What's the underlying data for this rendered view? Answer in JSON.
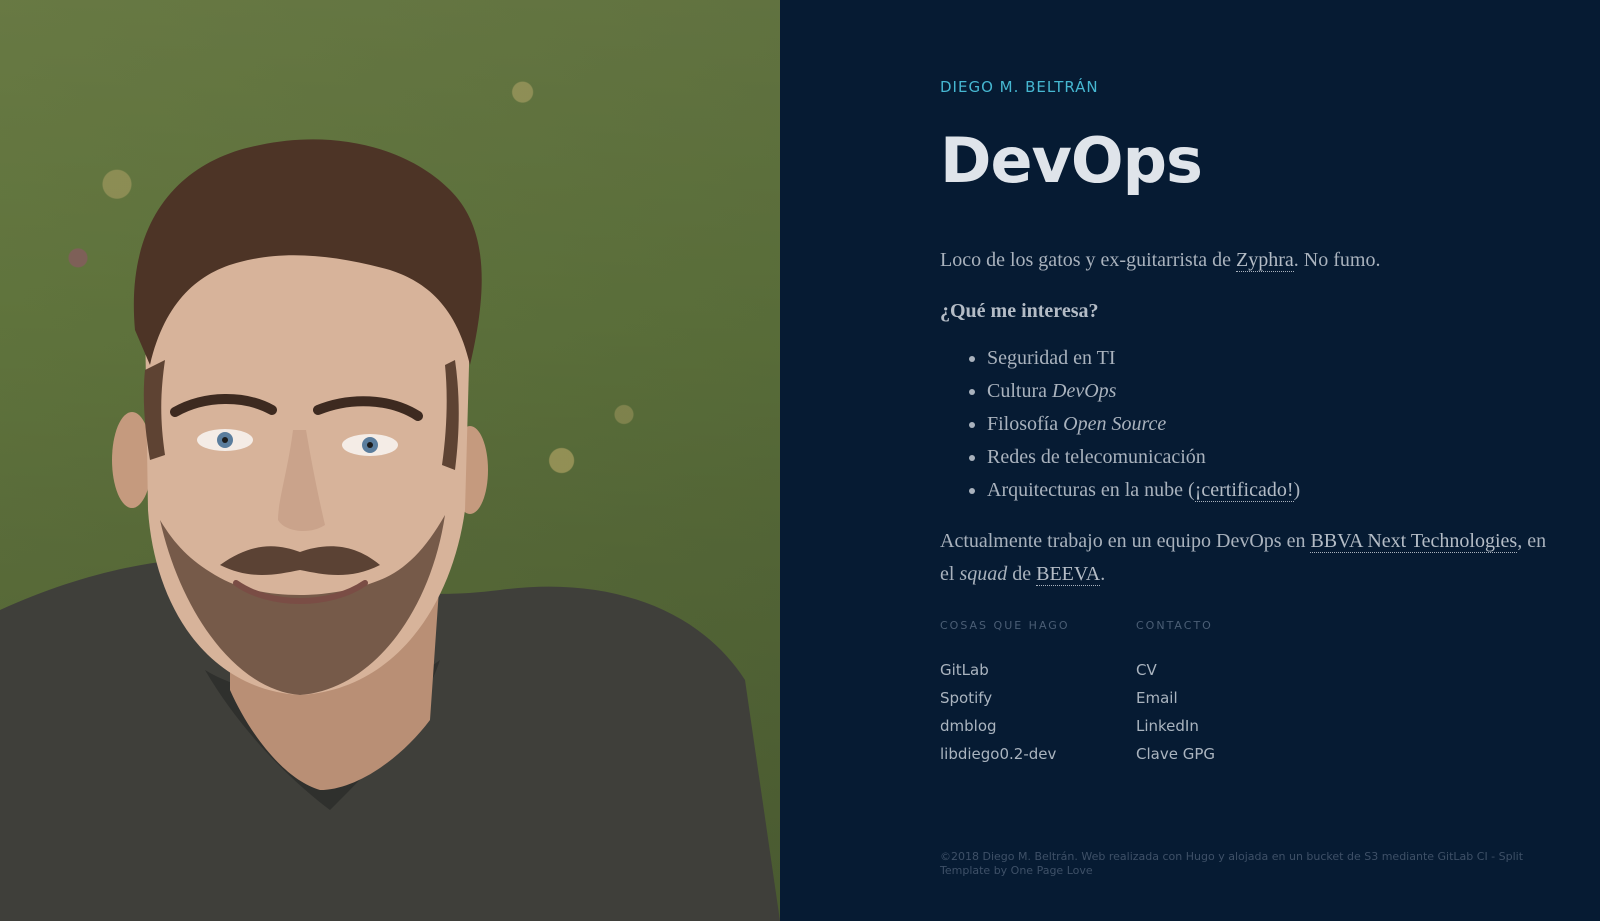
{
  "author_name": "DIEGO M. BELTRÁN",
  "headline": "DevOps",
  "intro": {
    "text_before": "Loco de los gatos y ex-guitarrista de ",
    "link": "Zyphra",
    "text_after": ". No fumo."
  },
  "interests": {
    "question": "¿Qué me interesa?",
    "items": [
      {
        "text": "Seguridad en TI"
      },
      {
        "text": "Cultura ",
        "italic": "DevOps"
      },
      {
        "text": "Filosofía ",
        "italic": "Open Source"
      },
      {
        "text": "Redes de telecomunicación"
      },
      {
        "text": "Arquitecturas en la nube (",
        "link": "¡certificado!",
        "suffix": ")"
      }
    ]
  },
  "current_job": {
    "text_before": "Actualmente trabajo en un equipo DevOps en ",
    "company_link": "BBVA Next Technologies",
    "text_middle": ", en el ",
    "italic": "squad",
    "text_de": " de ",
    "squad_link": "BEEVA",
    "text_after": "."
  },
  "sections": {
    "things": {
      "title": "COSAS QUE HAGO",
      "links": [
        "GitLab",
        "Spotify",
        "dmblog",
        "libdiego0.2-dev"
      ]
    },
    "contact": {
      "title": "CONTACTO",
      "links": [
        "CV",
        "Email",
        "LinkedIn",
        "Clave GPG"
      ]
    }
  },
  "footer": "©2018 Diego M. Beltrán. Web realizada con Hugo y alojada en un bucket de S3 mediante GitLab CI - Split Template by One Page Love",
  "colors": {
    "background": "#061b33",
    "accent": "#46b7d1",
    "heading": "#dfe4ea",
    "text": "#a9b2bd"
  }
}
